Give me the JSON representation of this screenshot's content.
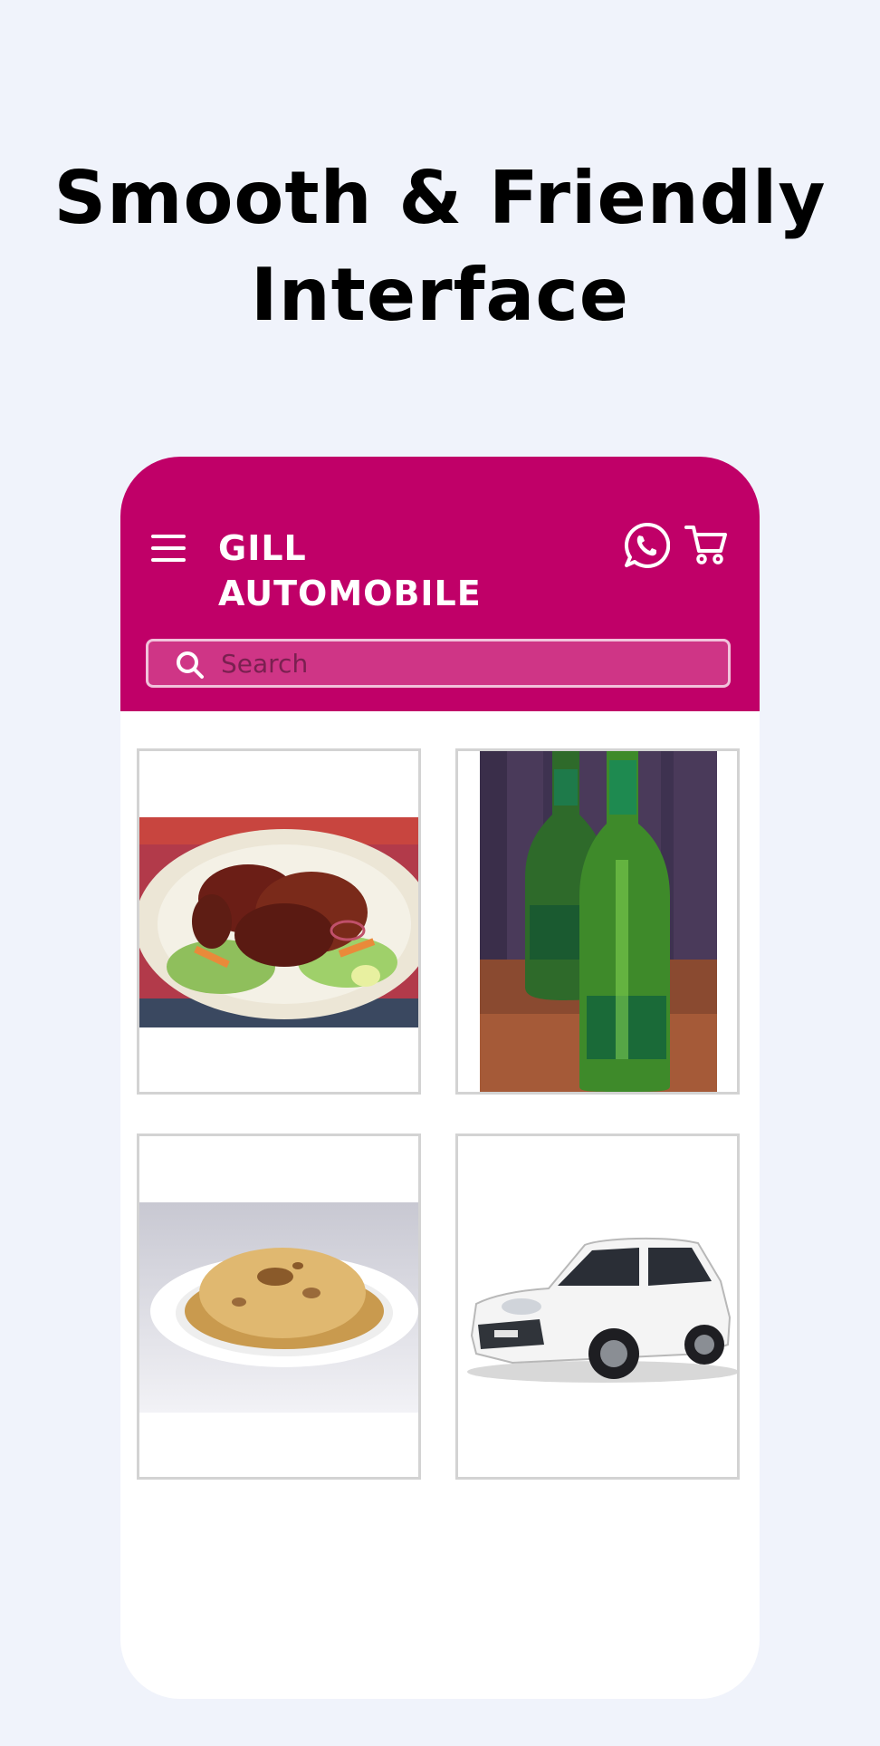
{
  "headline": {
    "line1": "Smooth & Friendly",
    "line2": "Interface"
  },
  "app": {
    "title_line1": "GILL",
    "title_line2": "AUTOMOBILE",
    "brand_color": "#c00068",
    "icons": {
      "menu": "hamburger-menu-icon",
      "whatsapp": "whatsapp-icon",
      "cart": "shopping-cart-icon",
      "search": "search-icon"
    }
  },
  "search": {
    "placeholder": "Search"
  },
  "products": [
    {
      "image": "roast-chicken-photo"
    },
    {
      "image": "beer-bottles-photo"
    },
    {
      "image": "roti-plate-photo"
    },
    {
      "image": "white-car-photo"
    }
  ]
}
